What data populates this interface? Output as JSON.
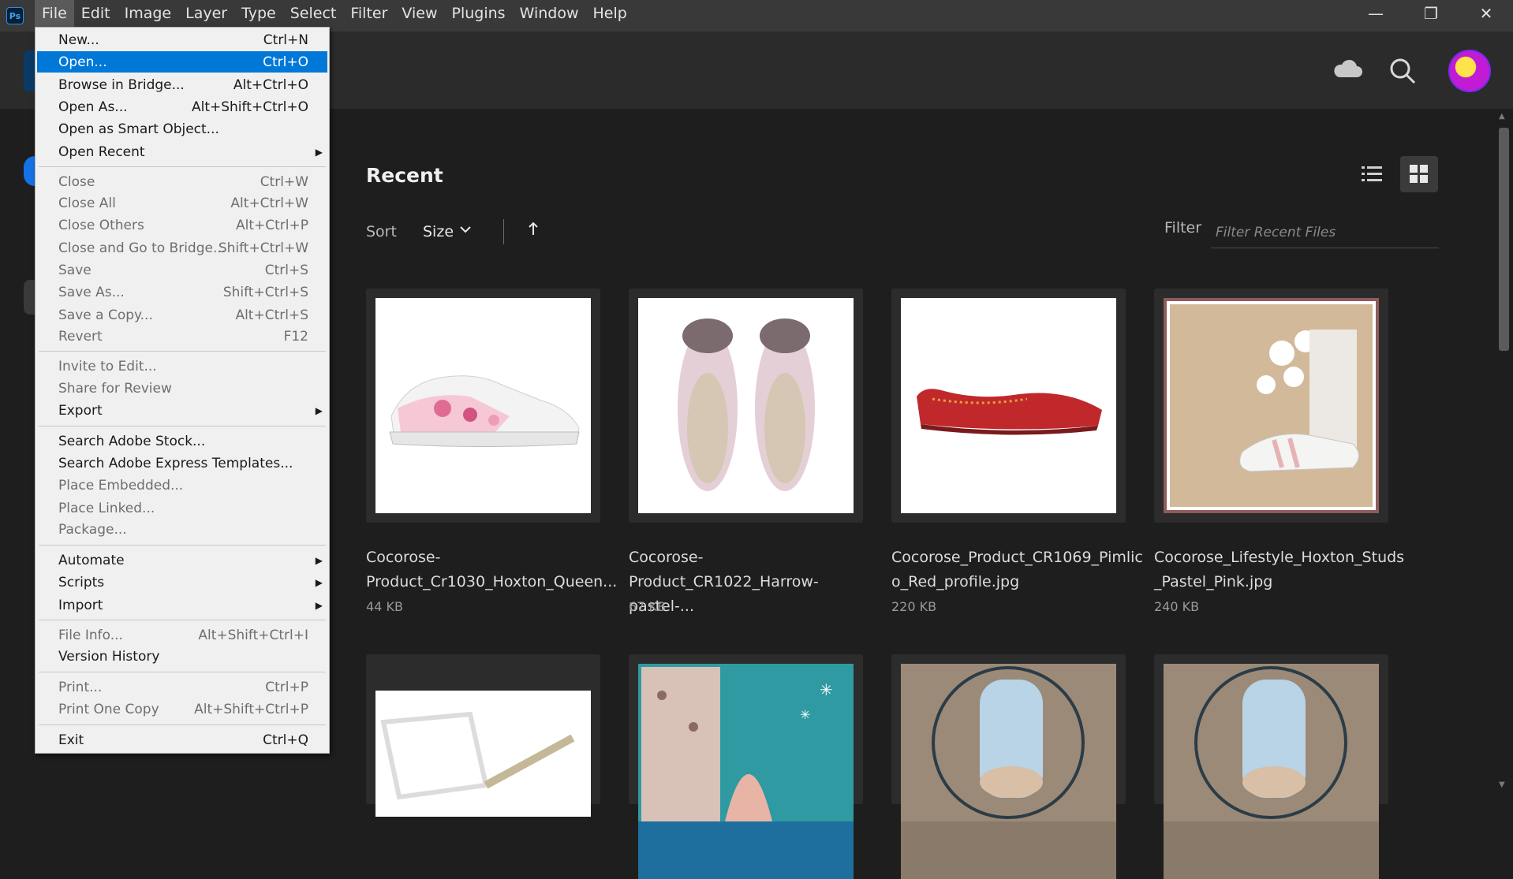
{
  "app": {
    "logo": "Ps",
    "menus": [
      "File",
      "Edit",
      "Image",
      "Layer",
      "Type",
      "Select",
      "Filter",
      "View",
      "Plugins",
      "Window",
      "Help"
    ],
    "active_menu": "File",
    "window_controls": {
      "minimize": "—",
      "restore": "❐",
      "close": "✕"
    }
  },
  "header": {
    "icons": [
      "cloud-icon",
      "search-icon",
      "avatar"
    ]
  },
  "recent": {
    "title": "Recent",
    "sort_label": "Sort",
    "sort_value": "Size",
    "filter_label": "Filter",
    "filter_placeholder": "Filter Recent Files",
    "files": [
      {
        "name": "Cocorose-Product_Cr1030_Hoxton_Queen...",
        "line1": "Cocorose-",
        "line2": "Product_Cr1030_Hoxton_Queen...",
        "size": "44 KB"
      },
      {
        "name": "Cocorose-Product_CR1022_Harrow-pastel-...",
        "line1": "Cocorose-",
        "line2": "Product_CR1022_Harrow-pastel-...",
        "size": "67 KB"
      },
      {
        "name": "Cocorose_Product_CR1069_Pimlico_Red_profile.jpg",
        "line1": "Cocorose_Product_CR1069_Pimlic",
        "line2": "o_Red_profile.jpg",
        "size": "220 KB"
      },
      {
        "name": "Cocorose_Lifestyle_Hoxton_Studs_Pastel_Pink.jpg",
        "line1": "Cocorose_Lifestyle_Hoxton_Studs",
        "line2": "_Pastel_Pink.jpg",
        "size": "240 KB"
      }
    ]
  },
  "file_menu": {
    "items": [
      {
        "label": "New...",
        "shortcut": "Ctrl+N",
        "enabled": true
      },
      {
        "label": "Open...",
        "shortcut": "Ctrl+O",
        "enabled": true,
        "highlighted": true
      },
      {
        "label": "Browse in Bridge...",
        "shortcut": "Alt+Ctrl+O",
        "enabled": true
      },
      {
        "label": "Open As...",
        "shortcut": "Alt+Shift+Ctrl+O",
        "enabled": true
      },
      {
        "label": "Open as Smart Object...",
        "shortcut": "",
        "enabled": true
      },
      {
        "label": "Open Recent",
        "shortcut": "",
        "enabled": true,
        "submenu": true
      },
      {
        "label": "Close",
        "shortcut": "Ctrl+W",
        "enabled": false
      },
      {
        "label": "Close All",
        "shortcut": "Alt+Ctrl+W",
        "enabled": false
      },
      {
        "label": "Close Others",
        "shortcut": "Alt+Ctrl+P",
        "enabled": false
      },
      {
        "label": "Close and Go to Bridge...",
        "shortcut": "Shift+Ctrl+W",
        "enabled": false
      },
      {
        "label": "Save",
        "shortcut": "Ctrl+S",
        "enabled": false
      },
      {
        "label": "Save As...",
        "shortcut": "Shift+Ctrl+S",
        "enabled": false
      },
      {
        "label": "Save a Copy...",
        "shortcut": "Alt+Ctrl+S",
        "enabled": false
      },
      {
        "label": "Revert",
        "shortcut": "F12",
        "enabled": false
      },
      {
        "label": "Invite to Edit...",
        "shortcut": "",
        "enabled": false
      },
      {
        "label": "Share for Review",
        "shortcut": "",
        "enabled": false
      },
      {
        "label": "Export",
        "shortcut": "",
        "enabled": true,
        "submenu": true
      },
      {
        "label": "Search Adobe Stock...",
        "shortcut": "",
        "enabled": true
      },
      {
        "label": "Search Adobe Express Templates...",
        "shortcut": "",
        "enabled": true
      },
      {
        "label": "Place Embedded...",
        "shortcut": "",
        "enabled": false
      },
      {
        "label": "Place Linked...",
        "shortcut": "",
        "enabled": false
      },
      {
        "label": "Package...",
        "shortcut": "",
        "enabled": false
      },
      {
        "label": "Automate",
        "shortcut": "",
        "enabled": true,
        "submenu": true
      },
      {
        "label": "Scripts",
        "shortcut": "",
        "enabled": true,
        "submenu": true
      },
      {
        "label": "Import",
        "shortcut": "",
        "enabled": true,
        "submenu": true
      },
      {
        "label": "File Info...",
        "shortcut": "Alt+Shift+Ctrl+I",
        "enabled": false
      },
      {
        "label": "Version History",
        "shortcut": "",
        "enabled": true
      },
      {
        "label": "Print...",
        "shortcut": "Ctrl+P",
        "enabled": false
      },
      {
        "label": "Print One Copy",
        "shortcut": "Alt+Shift+Ctrl+P",
        "enabled": false
      },
      {
        "label": "Exit",
        "shortcut": "Ctrl+Q",
        "enabled": true
      }
    ]
  },
  "colors": {
    "highlight": "#0078d7",
    "ps_blue": "#31a8ff"
  }
}
